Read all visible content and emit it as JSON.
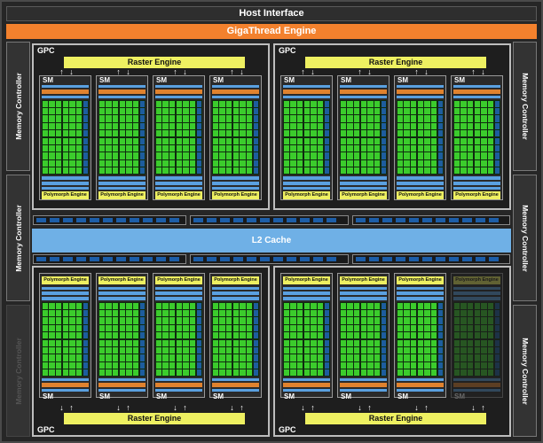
{
  "host_interface": "Host Interface",
  "gigathread_engine": "GigaThread Engine",
  "memory_controllers": [
    {
      "label": "Memory Controller",
      "dim": false
    },
    {
      "label": "Memory Controller",
      "dim": false
    },
    {
      "label": "Memory Controller",
      "dim": true
    },
    {
      "label": "Memory Controller",
      "dim": false
    },
    {
      "label": "Memory Controller",
      "dim": false
    },
    {
      "label": "Memory Controller",
      "dim": false
    }
  ],
  "l2_cache": "L2 Cache",
  "gpc_label": "GPC",
  "raster_engine": "Raster Engine",
  "sm_label": "SM",
  "polymorph_engine": "Polymorph Engine",
  "gpcs": [
    {
      "sms": [
        {
          "dim": false
        },
        {
          "dim": false
        },
        {
          "dim": false
        },
        {
          "dim": false
        }
      ]
    },
    {
      "sms": [
        {
          "dim": false
        },
        {
          "dim": false
        },
        {
          "dim": false
        },
        {
          "dim": false
        }
      ]
    },
    {
      "sms": [
        {
          "dim": false
        },
        {
          "dim": false
        },
        {
          "dim": false
        },
        {
          "dim": false
        }
      ]
    },
    {
      "sms": [
        {
          "dim": false
        },
        {
          "dim": false
        },
        {
          "dim": false
        },
        {
          "dim": true
        }
      ]
    }
  ],
  "colors": {
    "gigathread": "#f3812d",
    "raster": "#eef061",
    "core": "#3bcc2c",
    "cache": "#6fb0e6",
    "bus": "#1d5ea8"
  }
}
